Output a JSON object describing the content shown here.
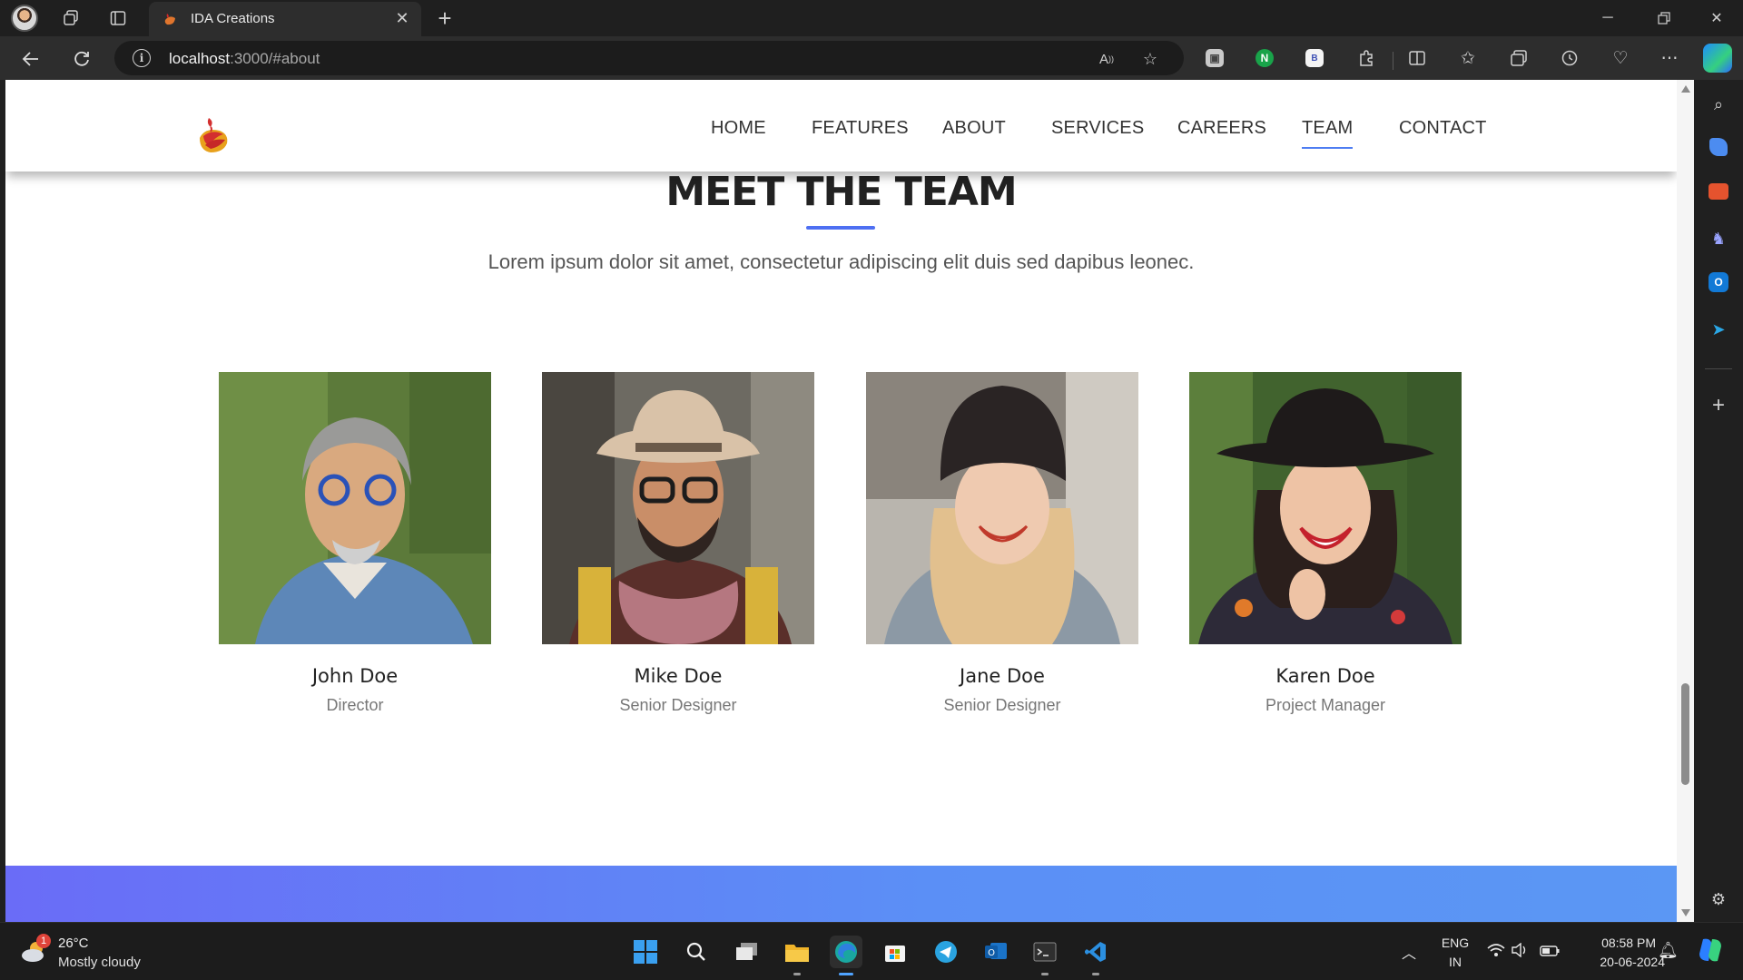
{
  "browser": {
    "tab_title": "IDA Creations",
    "url_host": "localhost",
    "url_path": ":3000/#about",
    "new_tab_label": "+",
    "tab_close_label": "✕"
  },
  "site": {
    "nav": [
      {
        "label": "HOME"
      },
      {
        "label": "FEATURES"
      },
      {
        "label": "ABOUT"
      },
      {
        "label": "SERVICES"
      },
      {
        "label": "CAREERS"
      },
      {
        "label": "TEAM"
      },
      {
        "label": "CONTACT"
      }
    ],
    "active_nav": "TEAM",
    "accent_color": "#4e7df2"
  },
  "team_section": {
    "title": "MEET THE TEAM",
    "subtitle": "Lorem ipsum dolor sit amet, consectetur adipiscing elit duis sed dapibus leonec.",
    "members": [
      {
        "name": "John Doe",
        "role": "Director"
      },
      {
        "name": "Mike Doe",
        "role": "Senior Designer"
      },
      {
        "name": "Jane Doe",
        "role": "Senior Designer"
      },
      {
        "name": "Karen Doe",
        "role": "Project Manager"
      }
    ]
  },
  "taskbar": {
    "weather_temp": "26°C",
    "weather_desc": "Mostly cloudy",
    "weather_badge": "1",
    "lang_line1": "ENG",
    "lang_line2": "IN",
    "time": "08:58 PM",
    "date": "20-06-2024"
  }
}
